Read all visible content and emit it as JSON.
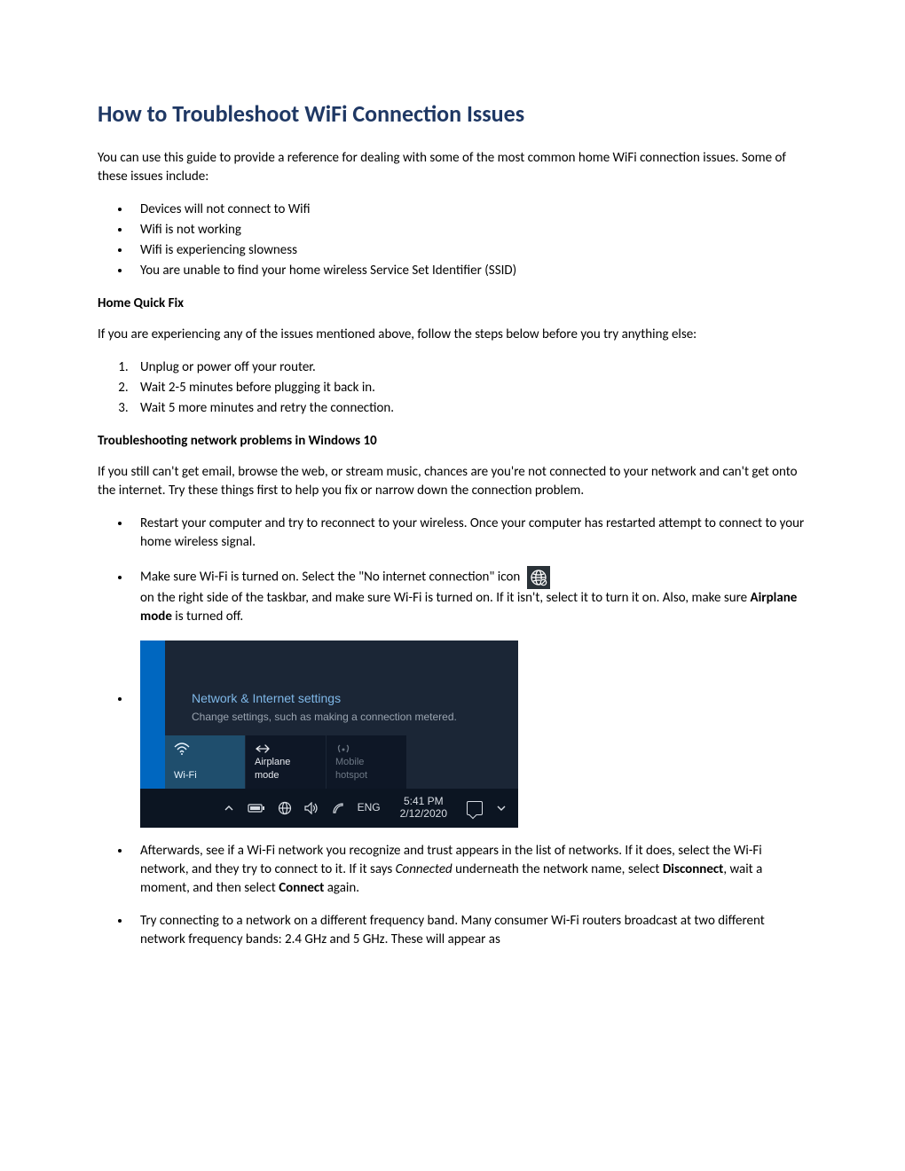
{
  "title": "How to Troubleshoot WiFi Connection Issues",
  "intro": "You can use this guide to provide a reference for dealing with some of the most common home WiFi connection issues.  Some of these issues include:",
  "issues": [
    "Devices will not connect to Wifi",
    "Wifi is not working",
    "Wifi is experiencing slowness",
    "You are unable to find your home wireless Service Set Identifier (SSID)"
  ],
  "quickfix": {
    "heading": "Home Quick Fix",
    "intro": "If you are experiencing any of the issues mentioned above, follow the steps below before you try anything else:",
    "steps": [
      "Unplug or power off your router.",
      "Wait 2-5 minutes before plugging it back in.",
      "Wait 5 more minutes and retry the connection."
    ]
  },
  "win10": {
    "heading": "Troubleshooting network problems in Windows 10",
    "intro": "If you still can't get email, browse the web, or stream music, chances are you're not connected to your network and can't get onto the internet. Try these things first to help you fix or narrow down the connection problem.",
    "bullet1": "Restart your computer and try to reconnect to your wireless. Once your computer has restarted attempt to connect to your home wireless signal.",
    "bullet2a": "Make sure Wi-Fi is turned on. Select the \"No internet connection\" icon",
    "bullet2b": "on the right side of the taskbar, and make sure Wi-Fi is turned on. If it isn't, select it to turn it on. Also, make sure ",
    "airplane_bold": "Airplane mode",
    "bullet2c": " is turned off.",
    "bullet3a": "Afterwards, see if a Wi-Fi network you recognize and trust appears in the list of networks. If it does, select the Wi-Fi network, and they try to connect to it. If it says ",
    "connected_ital": "Connected",
    "bullet3b": " underneath the network name, select ",
    "disconnect_bold": "Disconnect",
    "bullet3c": ", wait a moment, and then select ",
    "connect_bold": "Connect",
    "bullet3d": " again.",
    "bullet4": "Try connecting to a network on a different frequency band. Many consumer Wi-Fi routers broadcast at two different network frequency bands:  2.4 GHz and 5 GHz. These will appear as"
  },
  "flyout": {
    "link_title": "Network & Internet settings",
    "subtitle": "Change settings, such as making a connection metered.",
    "tiles": {
      "wifi": "Wi-Fi",
      "airplane": "Airplane mode",
      "hotspot_top": "Mobile",
      "hotspot_bottom": "hotspot"
    },
    "tray": {
      "eng": "ENG",
      "time": "5:41 PM",
      "date": "2/12/2020"
    }
  }
}
